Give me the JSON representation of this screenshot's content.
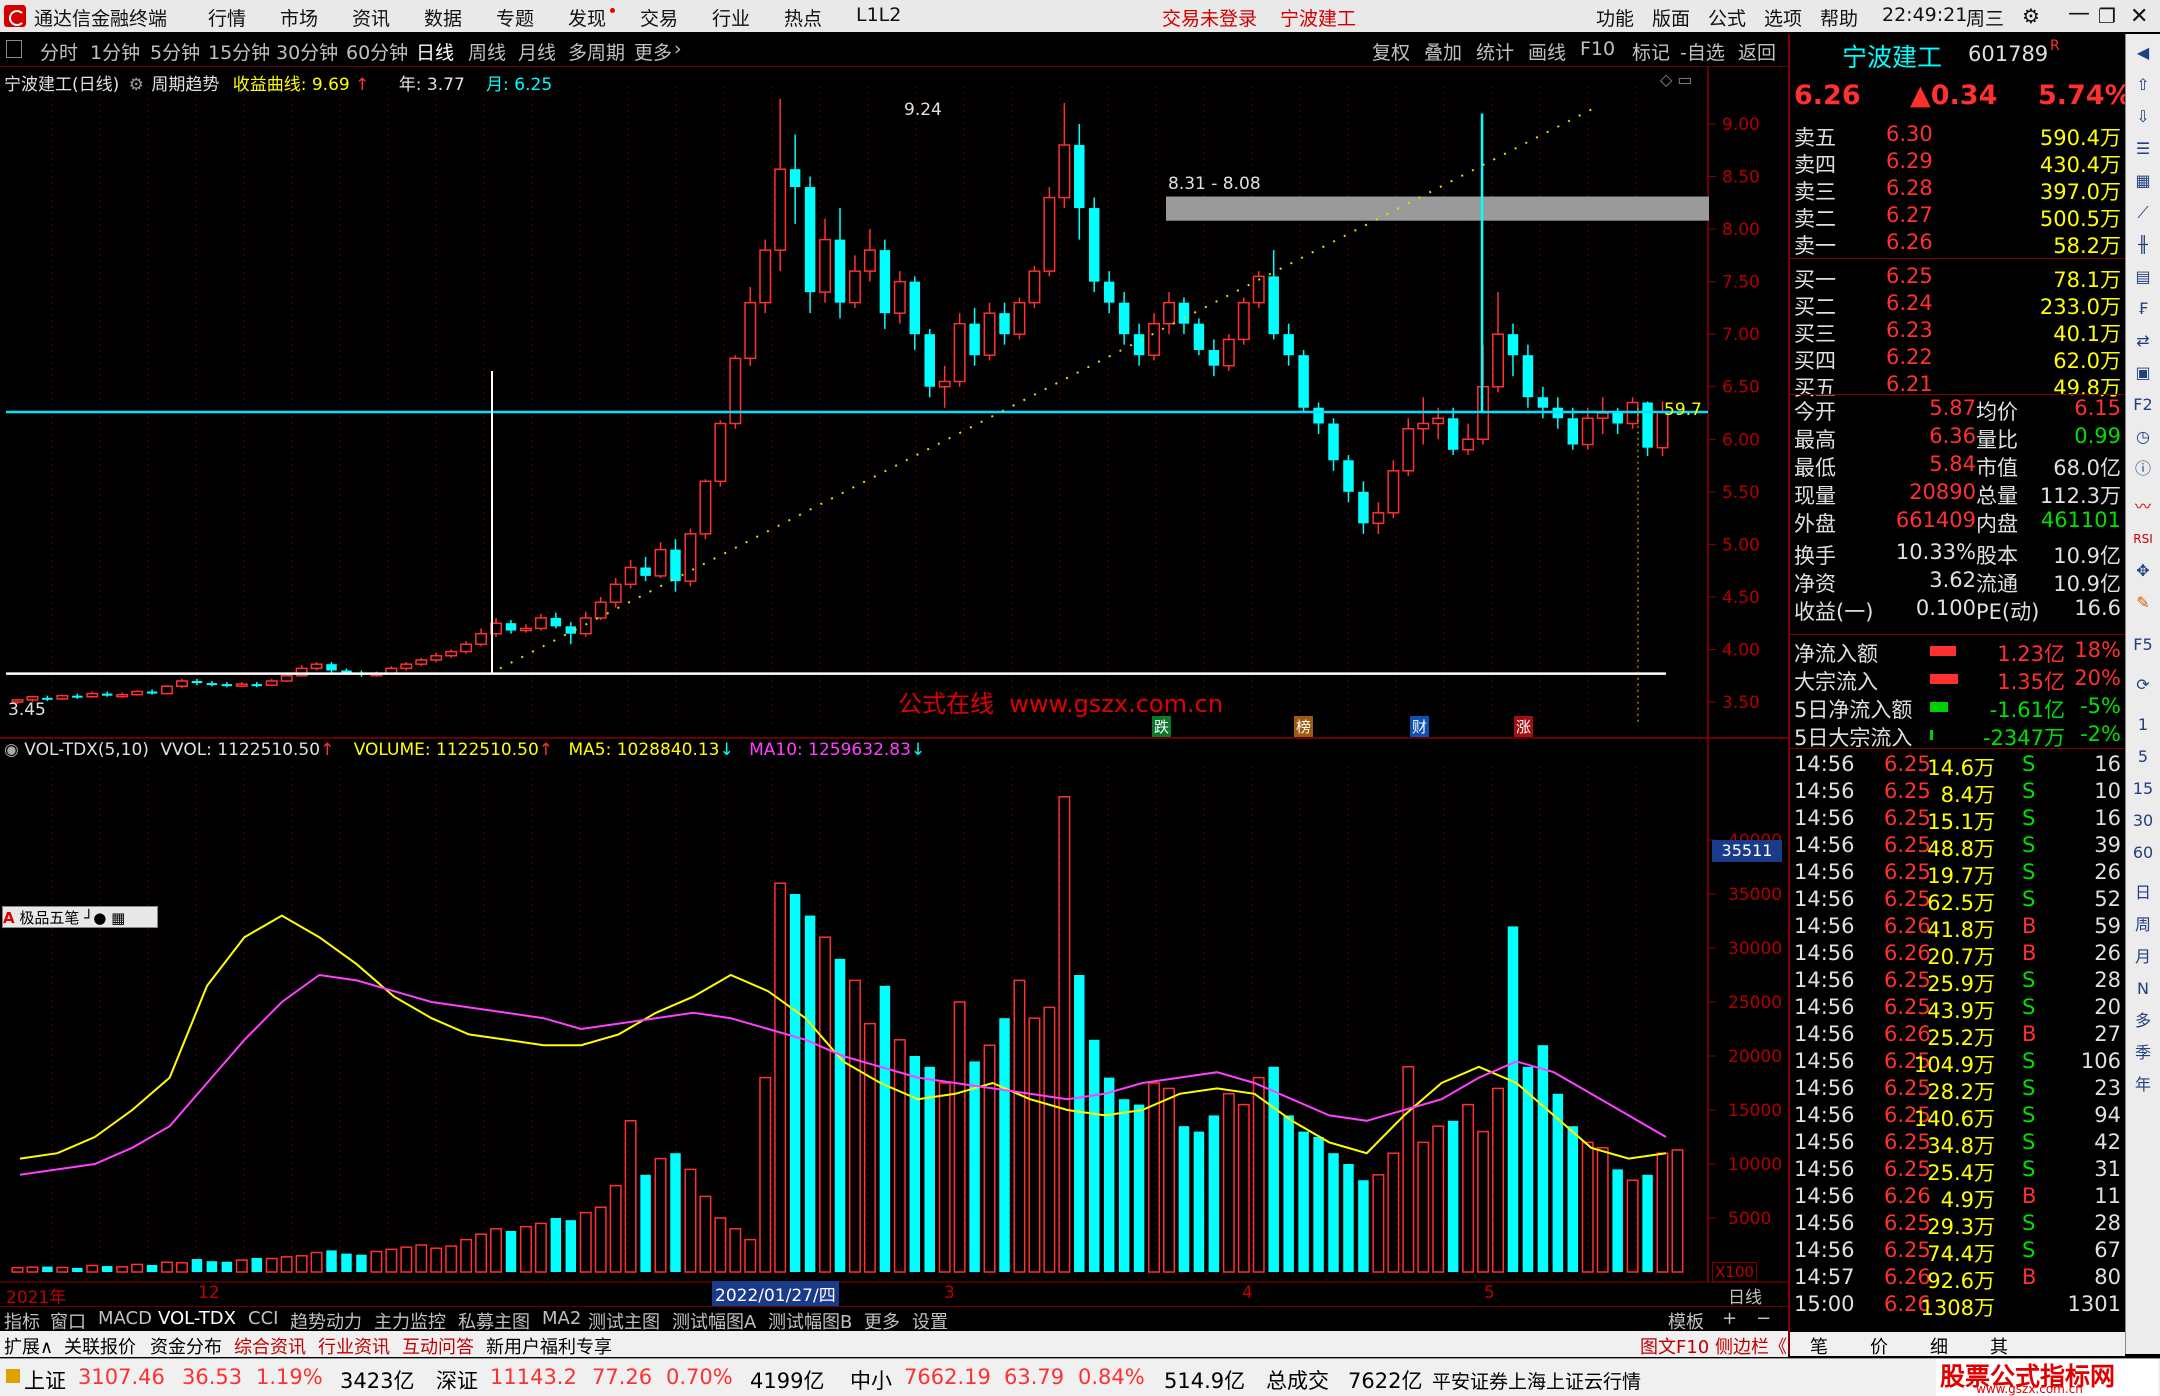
{
  "topbar": {
    "app_title": "通达信金融终端",
    "menus": [
      "行情",
      "市场",
      "资讯",
      "数据",
      "专题",
      "发现",
      "交易",
      "行业",
      "热点",
      "L1L2"
    ],
    "login_status": "交易未登录",
    "stock_name": "宁波建工",
    "right_menus": [
      "功能",
      "版面",
      "公式",
      "选项",
      "帮助"
    ],
    "time": "22:49:21",
    "weekday": "周三"
  },
  "periodbar": {
    "tabs": [
      "分时",
      "1分钟",
      "5分钟",
      "15分钟",
      "30分钟",
      "60分钟",
      "日线",
      "周线",
      "月线",
      "多周期",
      "更多"
    ],
    "active": "日线",
    "right_buttons": [
      "复权",
      "叠加",
      "统计",
      "画线",
      "F10",
      "标记",
      "-自选",
      "返回"
    ]
  },
  "chart_header": {
    "name": "宁波建工(日线)",
    "indicator": "周期趋势",
    "curve_label": "收益曲线: 9.69",
    "year_label": "年: 3.77",
    "month_label": "月: 6.25"
  },
  "annotations": {
    "high_label": "9.24",
    "zone_label": "8.31 - 8.08",
    "low_label": "3.45",
    "level_label": "59.7",
    "watermark": "公式在线  www.gszx.com.cn",
    "event_tags": [
      "跌",
      "榜",
      "财",
      "涨"
    ]
  },
  "vol_header": {
    "name": "VOL-TDX(5,10)",
    "vvol": "VVOL: 1122510.50",
    "volume": "VOLUME: 1122510.50",
    "ma5": "MA5: 1028840.13",
    "ma10": "MA10: 1259632.83"
  },
  "vol_badge": "35511",
  "vol_unit": "X100",
  "overlay_tool": "极品五笔",
  "xaxis": [
    "2021年",
    "12",
    "2022/01/27/四",
    "3",
    "4",
    "5",
    "日线"
  ],
  "price_axis": [
    "9.00",
    "8.50",
    "8.00",
    "7.50",
    "7.00",
    "6.50",
    "6.00",
    "5.50",
    "5.00",
    "4.50",
    "4.00",
    "3.50"
  ],
  "vol_axis": [
    "40000",
    "35000",
    "30000",
    "25000",
    "20000",
    "15000",
    "10000",
    "5000"
  ],
  "chart_data": {
    "type": "candlestick",
    "title": "宁波建工(日线)",
    "ylim": [
      3.3,
      9.4
    ],
    "candles": [
      [
        3.5,
        3.52,
        3.48,
        3.53
      ],
      [
        3.52,
        3.55,
        3.5,
        3.56
      ],
      [
        3.54,
        3.53,
        3.51,
        3.56
      ],
      [
        3.53,
        3.56,
        3.52,
        3.57
      ],
      [
        3.56,
        3.55,
        3.53,
        3.58
      ],
      [
        3.55,
        3.58,
        3.54,
        3.6
      ],
      [
        3.58,
        3.56,
        3.55,
        3.6
      ],
      [
        3.56,
        3.57,
        3.54,
        3.59
      ],
      [
        3.57,
        3.6,
        3.56,
        3.61
      ],
      [
        3.6,
        3.58,
        3.57,
        3.62
      ],
      [
        3.58,
        3.65,
        3.57,
        3.66
      ],
      [
        3.65,
        3.7,
        3.63,
        3.72
      ],
      [
        3.7,
        3.68,
        3.66,
        3.72
      ],
      [
        3.68,
        3.67,
        3.65,
        3.7
      ],
      [
        3.67,
        3.66,
        3.64,
        3.69
      ],
      [
        3.66,
        3.67,
        3.64,
        3.69
      ],
      [
        3.67,
        3.66,
        3.64,
        3.69
      ],
      [
        3.66,
        3.7,
        3.65,
        3.72
      ],
      [
        3.7,
        3.75,
        3.69,
        3.78
      ],
      [
        3.75,
        3.82,
        3.74,
        3.85
      ],
      [
        3.82,
        3.86,
        3.8,
        3.88
      ],
      [
        3.86,
        3.8,
        3.78,
        3.88
      ],
      [
        3.8,
        3.78,
        3.76,
        3.82
      ],
      [
        3.78,
        3.76,
        3.74,
        3.8
      ],
      [
        3.76,
        3.77,
        3.74,
        3.79
      ],
      [
        3.77,
        3.82,
        3.76,
        3.84
      ],
      [
        3.82,
        3.86,
        3.8,
        3.88
      ],
      [
        3.86,
        3.9,
        3.84,
        3.92
      ],
      [
        3.9,
        3.94,
        3.88,
        3.97
      ],
      [
        3.94,
        3.98,
        3.92,
        4.0
      ],
      [
        3.98,
        4.05,
        3.96,
        4.08
      ],
      [
        4.05,
        4.15,
        4.03,
        4.2
      ],
      [
        4.15,
        4.25,
        4.12,
        4.3
      ],
      [
        4.25,
        4.18,
        4.15,
        4.28
      ],
      [
        4.18,
        4.2,
        4.16,
        4.24
      ],
      [
        4.2,
        4.3,
        4.18,
        4.34
      ],
      [
        4.3,
        4.22,
        4.2,
        4.35
      ],
      [
        4.22,
        4.15,
        4.05,
        4.26
      ],
      [
        4.15,
        4.3,
        4.12,
        4.36
      ],
      [
        4.3,
        4.45,
        4.28,
        4.5
      ],
      [
        4.45,
        4.62,
        4.4,
        4.68
      ],
      [
        4.62,
        4.78,
        4.58,
        4.85
      ],
      [
        4.78,
        4.7,
        4.65,
        4.88
      ],
      [
        4.7,
        4.95,
        4.68,
        5.02
      ],
      [
        4.95,
        4.65,
        4.55,
        5.05
      ],
      [
        4.65,
        5.1,
        4.6,
        5.15
      ],
      [
        5.1,
        5.6,
        5.05,
        5.62
      ],
      [
        5.6,
        6.15,
        5.55,
        6.18
      ],
      [
        6.15,
        6.77,
        6.1,
        6.8
      ],
      [
        6.77,
        7.3,
        6.7,
        7.45
      ],
      [
        7.3,
        7.8,
        7.2,
        7.9
      ],
      [
        7.8,
        8.57,
        7.6,
        9.24
      ],
      [
        8.57,
        8.4,
        8.05,
        8.9
      ],
      [
        8.4,
        7.4,
        7.2,
        8.5
      ],
      [
        7.4,
        7.9,
        7.3,
        8.1
      ],
      [
        7.9,
        7.3,
        7.15,
        8.2
      ],
      [
        7.3,
        7.6,
        7.25,
        7.75
      ],
      [
        7.6,
        7.8,
        7.5,
        8.0
      ],
      [
        7.8,
        7.2,
        7.05,
        7.9
      ],
      [
        7.2,
        7.5,
        7.1,
        7.6
      ],
      [
        7.5,
        7.0,
        6.85,
        7.55
      ],
      [
        7.0,
        6.5,
        6.4,
        7.05
      ],
      [
        6.5,
        6.55,
        6.3,
        6.7
      ],
      [
        6.55,
        7.1,
        6.5,
        7.2
      ],
      [
        7.1,
        6.8,
        6.7,
        7.25
      ],
      [
        6.8,
        7.2,
        6.75,
        7.3
      ],
      [
        7.2,
        7.0,
        6.9,
        7.3
      ],
      [
        7.0,
        7.3,
        6.95,
        7.35
      ],
      [
        7.3,
        7.6,
        7.25,
        7.65
      ],
      [
        7.6,
        8.3,
        7.55,
        8.4
      ],
      [
        8.3,
        8.8,
        8.2,
        9.2
      ],
      [
        8.8,
        8.2,
        7.9,
        9.0
      ],
      [
        8.2,
        7.5,
        7.4,
        8.3
      ],
      [
        7.5,
        7.3,
        7.2,
        7.6
      ],
      [
        7.3,
        7.0,
        6.9,
        7.4
      ],
      [
        7.0,
        6.8,
        6.7,
        7.1
      ],
      [
        6.8,
        7.1,
        6.75,
        7.2
      ],
      [
        7.1,
        7.3,
        7.0,
        7.4
      ],
      [
        7.3,
        7.1,
        7.0,
        7.35
      ],
      [
        7.1,
        6.85,
        6.8,
        7.15
      ],
      [
        6.85,
        6.7,
        6.6,
        6.95
      ],
      [
        6.7,
        6.95,
        6.65,
        7.0
      ],
      [
        6.95,
        7.3,
        6.9,
        7.35
      ],
      [
        7.3,
        7.55,
        7.25,
        7.6
      ],
      [
        7.55,
        7.0,
        6.95,
        7.8
      ],
      [
        7.0,
        6.8,
        6.7,
        7.1
      ],
      [
        6.8,
        6.3,
        6.25,
        6.85
      ],
      [
        6.3,
        6.15,
        6.05,
        6.35
      ],
      [
        6.15,
        5.8,
        5.7,
        6.2
      ],
      [
        5.8,
        5.5,
        5.4,
        5.85
      ],
      [
        5.5,
        5.2,
        5.1,
        5.6
      ],
      [
        5.2,
        5.3,
        5.1,
        5.4
      ],
      [
        5.3,
        5.7,
        5.25,
        5.8
      ],
      [
        5.7,
        6.1,
        5.65,
        6.2
      ],
      [
        6.1,
        6.15,
        5.95,
        6.4
      ],
      [
        6.15,
        6.2,
        6.0,
        6.3
      ],
      [
        6.2,
        5.9,
        5.85,
        6.3
      ],
      [
        5.9,
        6.0,
        5.85,
        6.15
      ],
      [
        6.0,
        6.5,
        5.95,
        6.9
      ],
      [
        6.5,
        7.0,
        6.45,
        7.4
      ],
      [
        7.0,
        6.8,
        6.6,
        7.1
      ],
      [
        6.8,
        6.4,
        6.3,
        6.9
      ],
      [
        6.4,
        6.3,
        6.2,
        6.5
      ],
      [
        6.3,
        6.2,
        6.1,
        6.4
      ],
      [
        6.2,
        5.95,
        5.9,
        6.3
      ],
      [
        5.95,
        6.2,
        5.9,
        6.3
      ],
      [
        6.2,
        6.25,
        6.05,
        6.4
      ],
      [
        6.25,
        6.15,
        6.05,
        6.3
      ],
      [
        6.15,
        6.35,
        6.1,
        6.4
      ],
      [
        6.35,
        5.92,
        5.84,
        6.36
      ],
      [
        5.92,
        6.26,
        5.84,
        6.36
      ]
    ],
    "volumes": [
      400,
      450,
      500,
      420,
      380,
      600,
      550,
      480,
      700,
      650,
      900,
      850,
      1200,
      1000,
      950,
      1100,
      1300,
      1250,
      1400,
      1500,
      1800,
      2000,
      1700,
      1600,
      1900,
      2100,
      2300,
      2500,
      2200,
      2400,
      3000,
      3500,
      4000,
      3800,
      4200,
      4500,
      5000,
      4800,
      5500,
      6000,
      8000,
      14000,
      9000,
      10500,
      11000,
      9500,
      7000,
      5000,
      4000,
      3000,
      18000,
      36000,
      35000,
      33000,
      31000,
      29000,
      27000,
      23000,
      26500,
      21500,
      20000,
      19000,
      17500,
      25000,
      19500,
      21000,
      23500,
      27000,
      23500,
      24500,
      44000,
      27500,
      21500,
      18000,
      16000,
      15500,
      17500,
      17000,
      13500,
      13000,
      14500,
      16500,
      15500,
      18000,
      19000,
      14500,
      13000,
      12500,
      11000,
      10000,
      8500,
      9000,
      11000,
      19000,
      12000,
      13500,
      14000,
      15500,
      13000,
      17000,
      32000,
      19000,
      21000,
      16500,
      13500,
      12000,
      11500,
      9500,
      8500,
      9000,
      11000,
      11300
    ],
    "ma5_ref": [
      10500,
      11000,
      12500,
      15000,
      18000,
      26500,
      31000,
      33000,
      31000,
      28500,
      25500,
      23500,
      22000,
      21500,
      21000,
      21000,
      22000,
      24000,
      25500,
      27500,
      26000,
      23500,
      19500,
      17500,
      16000,
      16500,
      17500,
      16000,
      15000,
      14500,
      15000,
      16500,
      17000,
      16500,
      14000,
      12000,
      11000,
      14500,
      17500,
      19000,
      17500,
      14500,
      11500,
      10500,
      11000
    ],
    "ma10_ref": [
      9000,
      9500,
      10000,
      11500,
      13500,
      17500,
      21500,
      25000,
      27500,
      27000,
      26000,
      25000,
      24500,
      24000,
      23500,
      22500,
      23000,
      23500,
      24000,
      23500,
      22500,
      21500,
      20000,
      19000,
      18000,
      17500,
      17000,
      16500,
      16000,
      16500,
      17500,
      18000,
      18500,
      17500,
      16000,
      14500,
      14000,
      15000,
      16000,
      18000,
      19500,
      18500,
      16500,
      14500,
      12500
    ]
  },
  "quote": {
    "name": "宁波建工",
    "code": "601789",
    "price": "6.26",
    "change": "▲0.34",
    "pct": "5.74%",
    "asks": [
      [
        "卖五",
        "6.30",
        "590.4万"
      ],
      [
        "卖四",
        "6.29",
        "430.4万"
      ],
      [
        "卖三",
        "6.28",
        "397.0万"
      ],
      [
        "卖二",
        "6.27",
        "500.5万"
      ],
      [
        "卖一",
        "6.26",
        "58.2万"
      ]
    ],
    "bids": [
      [
        "买一",
        "6.25",
        "78.1万"
      ],
      [
        "买二",
        "6.24",
        "233.0万"
      ],
      [
        "买三",
        "6.23",
        "40.1万"
      ],
      [
        "买四",
        "6.22",
        "62.0万"
      ],
      [
        "买五",
        "6.21",
        "49.8万"
      ]
    ],
    "stats": [
      [
        "今开",
        "5.87",
        "均价",
        "6.15"
      ],
      [
        "最高",
        "6.36",
        "量比",
        "0.99"
      ],
      [
        "最低",
        "5.84",
        "市值",
        "68.0亿"
      ],
      [
        "现量",
        "20890",
        "总量",
        "112.3万"
      ],
      [
        "外盘",
        "661409",
        "内盘",
        "461101"
      ],
      [
        "换手",
        "10.33%",
        "股本",
        "10.9亿"
      ],
      [
        "净资",
        "3.62",
        "流通",
        "10.9亿"
      ],
      [
        "收益(一)",
        "0.100",
        "PE(动)",
        "16.6"
      ]
    ],
    "flows": [
      [
        "净流入额",
        "1.23亿",
        "18%"
      ],
      [
        "大宗流入",
        "1.35亿",
        "20%"
      ],
      [
        "5日净流入额",
        "-1.61亿",
        "-5%"
      ],
      [
        "5日大宗流入",
        "-2347万",
        "-2%"
      ]
    ],
    "ticks": [
      [
        "14:56",
        "6.25",
        "14.6万",
        "S",
        "16"
      ],
      [
        "14:56",
        "6.25",
        "8.4万",
        "S",
        "10"
      ],
      [
        "14:56",
        "6.25",
        "15.1万",
        "S",
        "16"
      ],
      [
        "14:56",
        "6.25",
        "48.8万",
        "S",
        "39"
      ],
      [
        "14:56",
        "6.25",
        "19.7万",
        "S",
        "26"
      ],
      [
        "14:56",
        "6.25",
        "62.5万",
        "S",
        "52"
      ],
      [
        "14:56",
        "6.26",
        "41.8万",
        "B",
        "59"
      ],
      [
        "14:56",
        "6.26",
        "20.7万",
        "B",
        "26"
      ],
      [
        "14:56",
        "6.25",
        "25.9万",
        "S",
        "28"
      ],
      [
        "14:56",
        "6.25",
        "43.9万",
        "S",
        "20"
      ],
      [
        "14:56",
        "6.26",
        "25.2万",
        "B",
        "27"
      ],
      [
        "14:56",
        "6.25",
        "104.9万",
        "S",
        "106"
      ],
      [
        "14:56",
        "6.25",
        "28.2万",
        "S",
        "23"
      ],
      [
        "14:56",
        "6.25",
        "140.6万",
        "S",
        "94"
      ],
      [
        "14:56",
        "6.25",
        "34.8万",
        "S",
        "42"
      ],
      [
        "14:56",
        "6.25",
        "25.4万",
        "S",
        "31"
      ],
      [
        "14:56",
        "6.26",
        "4.9万",
        "B",
        "11"
      ],
      [
        "14:56",
        "6.25",
        "29.3万",
        "S",
        "28"
      ],
      [
        "14:56",
        "6.25",
        "74.4万",
        "S",
        "67"
      ],
      [
        "14:57",
        "6.26",
        "92.6万",
        "B",
        "80"
      ],
      [
        "15:00",
        "6.26",
        "1308万",
        "",
        "1301"
      ]
    ]
  },
  "tabs": {
    "indicators": [
      "指标",
      "窗口",
      "MACD",
      "VOL-TDX",
      "CCI",
      "趋势动力",
      "主力监控",
      "私募主图",
      "MA2",
      "测试主图",
      "测试幅图A",
      "测试幅图B",
      "更多",
      "设置"
    ],
    "template": "模板",
    "info_tabs": [
      "扩展∧",
      "关联报价",
      "资金分布",
      "综合资讯",
      "行业资讯",
      "互动问答",
      "新用户福利专享"
    ],
    "right_info": "图文F10 侧边栏《",
    "right_tabs": [
      "笔",
      "价",
      "细",
      "其"
    ]
  },
  "statusbar": {
    "sh_label": "上证",
    "sh_val": "3107.46",
    "sh_chg": "36.53",
    "sh_pct": "1.19%",
    "sh_amt": "3423亿",
    "sz_label": "深证",
    "sz_val": "11143.2",
    "sz_chg": "77.26",
    "sz_pct": "0.70%",
    "sz_amt": "4199亿",
    "zx_label": "中小",
    "zx_val": "7662.19",
    "zx_chg": "63.79",
    "zx_pct": "0.84%",
    "zx_amt": "514.9亿",
    "total_label": "总成交",
    "total_val": "7622亿",
    "server": "平安证券上海上证云行情",
    "brand": "股票公式指标网",
    "brand_url": "www.gszx.com.cn"
  },
  "colors": {
    "up": "#ff3030",
    "down": "#00ffff",
    "bg": "#000000",
    "grid": "#8b0000",
    "ma5": "#ffff00",
    "ma10": "#ff40ff"
  }
}
